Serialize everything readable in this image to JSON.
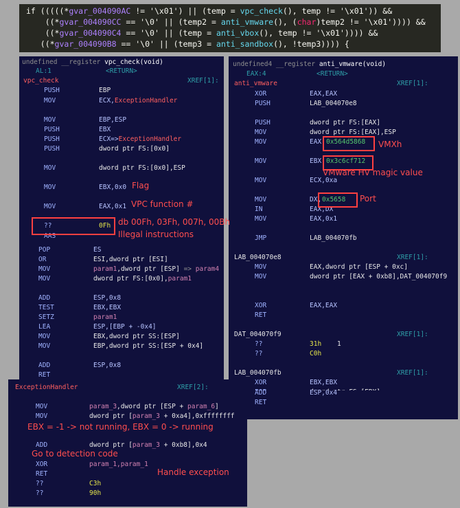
{
  "top_code": {
    "l1": {
      "a": "if (((((*",
      "b": "gvar_004090AC",
      "c": " != '\\x01') || (temp = ",
      "d": "vpc_check",
      "e": "(), temp != '\\x01')) &&"
    },
    "l2": {
      "a": "    ((*",
      "b": "gvar_004090CC",
      "c": " == '\\0' || (temp2 = ",
      "d": "anti_vmware",
      "e": "(), (",
      "f": "char",
      "g": ")temp2 != '\\x01')))) &&"
    },
    "l3": {
      "a": "    ((*",
      "b": "gvar_004090C4",
      "c": " == '\\0' || (temp = ",
      "d": "anti_vbox",
      "e": "(), temp != '\\x01')))) &&"
    },
    "l4": {
      "a": "   ((*",
      "b": "gvar_004090B8",
      "c": " == '\\0' || (temp3 = ",
      "d": "anti_sandbox",
      "e": "(), !temp3)))) {"
    }
  },
  "vpc": {
    "sig_a": "undefined __register ",
    "sig_b": "vpc_check(void)",
    "al": "AL:1",
    "ret": "<RETURN>",
    "label": "vpc_check",
    "xref": "XREF[1]:",
    "rows": [
      {
        "m": "PUSH",
        "o": "EBP"
      },
      {
        "m": "MOV",
        "o": "ECX,ExceptionHandler"
      },
      {
        "m": "MOV",
        "o": "EBP,ESP"
      },
      {
        "m": "PUSH",
        "o": "EBX"
      },
      {
        "m": "PUSH",
        "o": "ECX=>ExceptionHandler"
      },
      {
        "m": "PUSH",
        "o": "dword ptr FS:[0x0]"
      },
      {
        "m": "MOV",
        "o": "dword ptr FS:[0x0],ESP"
      },
      {
        "m": "MOV",
        "o": "EBX,0x0"
      },
      {
        "m": "MOV",
        "o": "EAX,0x1"
      },
      {
        "m": "??",
        "o": "0Fh"
      },
      {
        "m": "AAS",
        "o": ""
      },
      {
        "m": "POP",
        "o": "ES"
      },
      {
        "m": "OR",
        "o": "ESI,dword ptr [ESI]"
      },
      {
        "m": "MOV",
        "o": "param1,dword ptr [ESP] => param4"
      },
      {
        "m": "MOV",
        "o": "dword ptr FS:[0x0],param1"
      },
      {
        "m": "ADD",
        "o": "ESP,0x8"
      },
      {
        "m": "TEST",
        "o": "EBX,EBX"
      },
      {
        "m": "SETZ",
        "o": "param1"
      },
      {
        "m": "LEA",
        "o": "ESP,[EBP + -0x4]"
      },
      {
        "m": "MOV",
        "o": "EBX,dword ptr SS:[ESP]"
      },
      {
        "m": "MOV",
        "o": "EBP,dword ptr SS:[ESP + 0x4]"
      },
      {
        "m": "ADD",
        "o": "ESP,0x8"
      },
      {
        "m": "RET",
        "o": ""
      }
    ]
  },
  "vmw": {
    "sig_a": "undefined4 __register ",
    "sig_b": "anti_vmware(void)",
    "eax": "EAX:4",
    "ret": "<RETURN>",
    "label": "anti_vmware",
    "xref": "XREF[1]:",
    "rows": [
      {
        "m": "XOR",
        "o": "EAX,EAX"
      },
      {
        "m": "PUSH",
        "o": "LAB_004070e8"
      },
      {
        "m": "PUSH",
        "o": "dword ptr FS:[EAX]"
      },
      {
        "m": "MOV",
        "o": "dword ptr FS:[EAX],ESP"
      },
      {
        "m": "MOV",
        "o": "EAX,",
        "v": "0x564d5868"
      },
      {
        "m": "MOV",
        "o": "EBX,",
        "v": "0x3c6cf712"
      },
      {
        "m": "MOV",
        "o": "ECX,0xa"
      },
      {
        "m": "MOV",
        "o": "DX,",
        "v": "0x5658"
      },
      {
        "m": "IN",
        "o": "EAX,DX"
      },
      {
        "m": "MOV",
        "o": "EAX,0x1"
      },
      {
        "m": "JMP",
        "o": "LAB_004070fb"
      }
    ],
    "lab2": "LAB_004070e8",
    "xref2": "XREF[1]:",
    "rows2": [
      {
        "m": "MOV",
        "o": "EAX,dword ptr [ESP + 0xc]"
      },
      {
        "m": "MOV",
        "o": "dword ptr [EAX + 0xb8],DAT_004070f9"
      },
      {
        "m": "XOR",
        "o": "EAX,EAX"
      },
      {
        "m": "RET",
        "o": ""
      }
    ],
    "dat": "DAT_004070f9",
    "xref3": "XREF[1]:",
    "db1": {
      "m": "??",
      "o": "31h",
      "c": "1"
    },
    "db2": {
      "m": "??",
      "o": "C0h"
    },
    "lab3": "LAB_004070fb",
    "xref4": "XREF[1]:",
    "rows3": [
      {
        "m": "XOR",
        "o": "EBX,EBX"
      },
      {
        "m": "POP",
        "o": "dword ptr FS:[EBX]"
      },
      {
        "m": "ADD",
        "o": "ESP,0x4"
      },
      {
        "m": "RET",
        "o": ""
      }
    ]
  },
  "exh": {
    "label": "ExceptionHandler",
    "xref": "XREF[2]:",
    "behind": "vp",
    "rows": [
      {
        "m": "MOV",
        "o": "param_3,dword ptr [ESP + param_6]"
      },
      {
        "m": "MOV",
        "o": "dword ptr [param_3 + 0xa4],0xffffffff"
      },
      {
        "m": "ADD",
        "o": "dword ptr [param_3 + 0xb8],0x4"
      },
      {
        "m": "XOR",
        "o": "param_1,param_1"
      },
      {
        "m": "RET",
        "o": ""
      },
      {
        "m": "??",
        "o": "C3h"
      },
      {
        "m": "??",
        "o": "90h"
      }
    ]
  },
  "annotations": {
    "flag": "Flag",
    "vpc_fn": "VPC function #",
    "db": "db 00Fh, 03Fh, 007h, 00Bh",
    "illegal": "Illegal instructions",
    "vmxh": "VMXh",
    "magic": "VMware HV magic value",
    "port": "Port",
    "ebx": "EBX = -1 -> not running, EBX = 0 -> running",
    "goto": "Go to detection code",
    "handle": "Handle exception"
  }
}
